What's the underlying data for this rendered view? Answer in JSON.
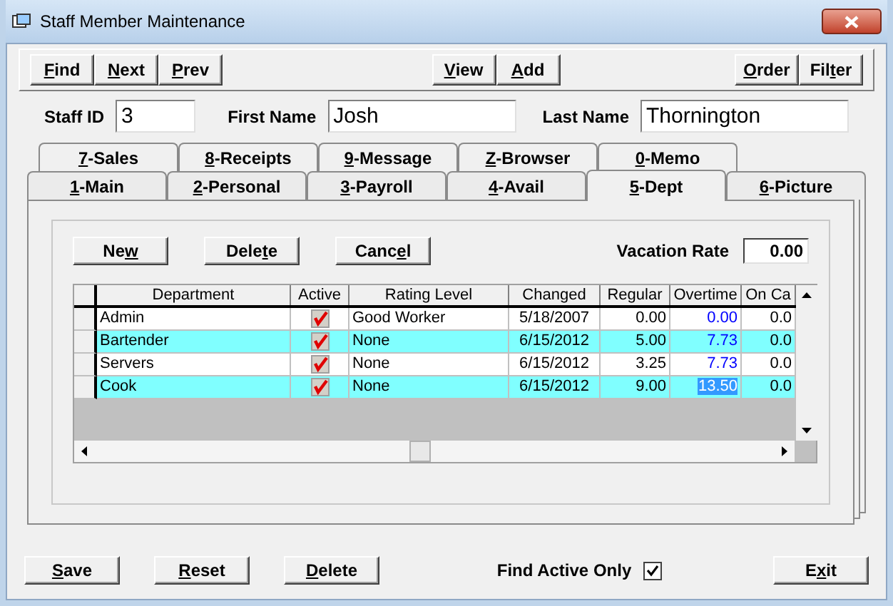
{
  "window": {
    "title": "Staff Member Maintenance"
  },
  "toolbar": {
    "left": [
      {
        "key": "F",
        "after": "ind"
      },
      {
        "key": "N",
        "after": "ext"
      },
      {
        "key": "P",
        "after": "rev"
      }
    ],
    "center": [
      {
        "key": "V",
        "after": "iew"
      },
      {
        "key": "A",
        "after": "dd"
      }
    ],
    "right": [
      {
        "key": "O",
        "after": "rder"
      },
      {
        "before": "Fil",
        "key": "t",
        "after": "er"
      }
    ]
  },
  "fields": [
    {
      "label": "Staff ID",
      "value": "3"
    },
    {
      "label": "First Name",
      "value": "Josh"
    },
    {
      "label": "Last Name",
      "value": "Thornington"
    }
  ],
  "tabs_back": [
    {
      "key": "7",
      "after": "-Sales",
      "selected": false
    },
    {
      "key": "8",
      "after": "-Receipts",
      "selected": false
    },
    {
      "key": "9",
      "after": "-Message",
      "selected": false
    },
    {
      "key": "Z",
      "after": "-Browser",
      "selected": false
    },
    {
      "key": "0",
      "after": "-Memo",
      "selected": false
    }
  ],
  "tabs_front": [
    {
      "key": "1",
      "after": "-Main",
      "selected": false
    },
    {
      "key": "2",
      "after": "-Personal",
      "selected": false
    },
    {
      "key": "3",
      "after": "-Payroll",
      "selected": false
    },
    {
      "key": "4",
      "after": "-Avail",
      "selected": false
    },
    {
      "key": "5",
      "after": "-Dept",
      "selected": true
    },
    {
      "key": "6",
      "after": "-Picture",
      "selected": false
    }
  ],
  "dept_buttons": [
    {
      "before": "Ne",
      "key": "w"
    },
    {
      "before": "Dele",
      "key": "t",
      "after": "e"
    },
    {
      "before": "Canc",
      "key": "e",
      "after": "l"
    }
  ],
  "vacation_rate": {
    "label": "Vacation Rate",
    "value": "0.00"
  },
  "grid": {
    "columns": [
      "Department",
      "Active",
      "Rating Level",
      "Changed",
      "Regular",
      "Overtime",
      "On Ca"
    ],
    "rows": [
      {
        "department": "Admin",
        "active": true,
        "rating_level": "Good Worker",
        "changed": "5/18/2007",
        "regular": "0.00",
        "overtime": "0.00",
        "on_call": "0.0",
        "highlighted": false,
        "overtime_selected": false
      },
      {
        "department": "Bartender",
        "active": true,
        "rating_level": "None",
        "changed": "6/15/2012",
        "regular": "5.00",
        "overtime": "7.73",
        "on_call": "0.0",
        "highlighted": true,
        "overtime_selected": false
      },
      {
        "department": "Servers",
        "active": true,
        "rating_level": "None",
        "changed": "6/15/2012",
        "regular": "3.25",
        "overtime": "7.73",
        "on_call": "0.0",
        "highlighted": false,
        "overtime_selected": false
      },
      {
        "department": "Cook",
        "active": true,
        "rating_level": "None",
        "changed": "6/15/2012",
        "regular": "9.00",
        "overtime": "13.50",
        "on_call": "0.0",
        "highlighted": true,
        "overtime_selected": true
      }
    ]
  },
  "bottom_buttons": [
    {
      "key": "S",
      "after": "ave"
    },
    {
      "key": "R",
      "after": "eset"
    },
    {
      "key": "D",
      "after": "elete"
    }
  ],
  "find_active_only": {
    "label": "Find Active Only",
    "checked": true
  },
  "exit_button": {
    "before": "E",
    "key": "x",
    "after": "it"
  }
}
